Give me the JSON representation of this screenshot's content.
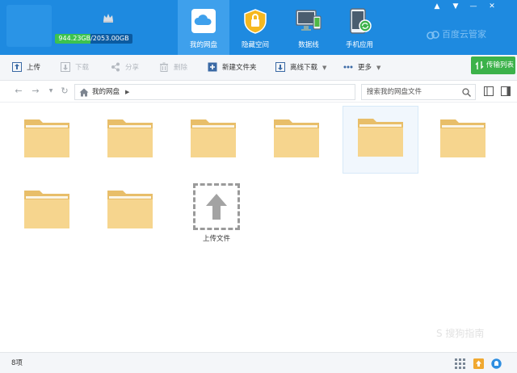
{
  "account": {
    "quota": "944.23GB/2053.00GB",
    "quota_fraction": 0.46
  },
  "nav_tabs": [
    {
      "label": "我的网盘",
      "icon": "cloud-icon",
      "active": true
    },
    {
      "label": "隐藏空间",
      "icon": "lock-icon",
      "active": false
    },
    {
      "label": "数据线",
      "icon": "devices-icon",
      "active": false
    },
    {
      "label": "手机应用",
      "icon": "phone-app-icon",
      "active": false
    }
  ],
  "brand": {
    "name": "百度云管家"
  },
  "toolbar": {
    "upload": "上传",
    "download": "下载",
    "share": "分享",
    "delete": "删除",
    "new_folder": "新建文件夹",
    "offline_download": "离线下载",
    "more": "更多",
    "transfer_list": "传输列表"
  },
  "addressbar": {
    "breadcrumb": "我的网盘",
    "search_placeholder": "搜索我的网盘文件"
  },
  "upload_tile": {
    "label": "上传文件"
  },
  "status": {
    "count": "8项"
  },
  "watermark": "S 搜狗指南",
  "colors": {
    "header": "#1e8ae0",
    "active_tab": "#3ea0ec",
    "folder": "#f6d58e",
    "transfer_button": "#3cb24a"
  }
}
